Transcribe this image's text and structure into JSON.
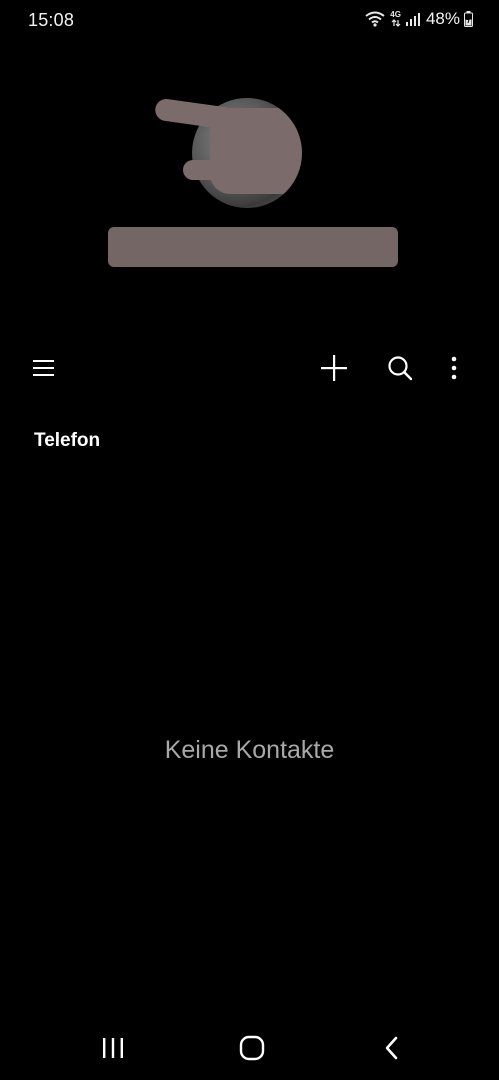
{
  "status_bar": {
    "time": "15:08",
    "network_type": "4G",
    "battery_percent": "48%",
    "icons": [
      "wifi-icon",
      "network-4g-icon",
      "signal-icon",
      "battery-charging-icon"
    ]
  },
  "profile": {
    "avatar_redacted": true,
    "name_redacted": true
  },
  "toolbar": {
    "icons": [
      "menu-icon",
      "add-icon",
      "search-icon",
      "more-options-icon"
    ]
  },
  "section": {
    "title": "Telefon"
  },
  "empty_state": {
    "message": "Keine Kontakte"
  },
  "nav_bar": {
    "icons": [
      "recents-icon",
      "home-icon",
      "back-icon"
    ]
  },
  "colors": {
    "background": "#000000",
    "text_primary": "#ffffff",
    "text_secondary": "#a8a8a8",
    "redaction": "#7b6b6b"
  }
}
